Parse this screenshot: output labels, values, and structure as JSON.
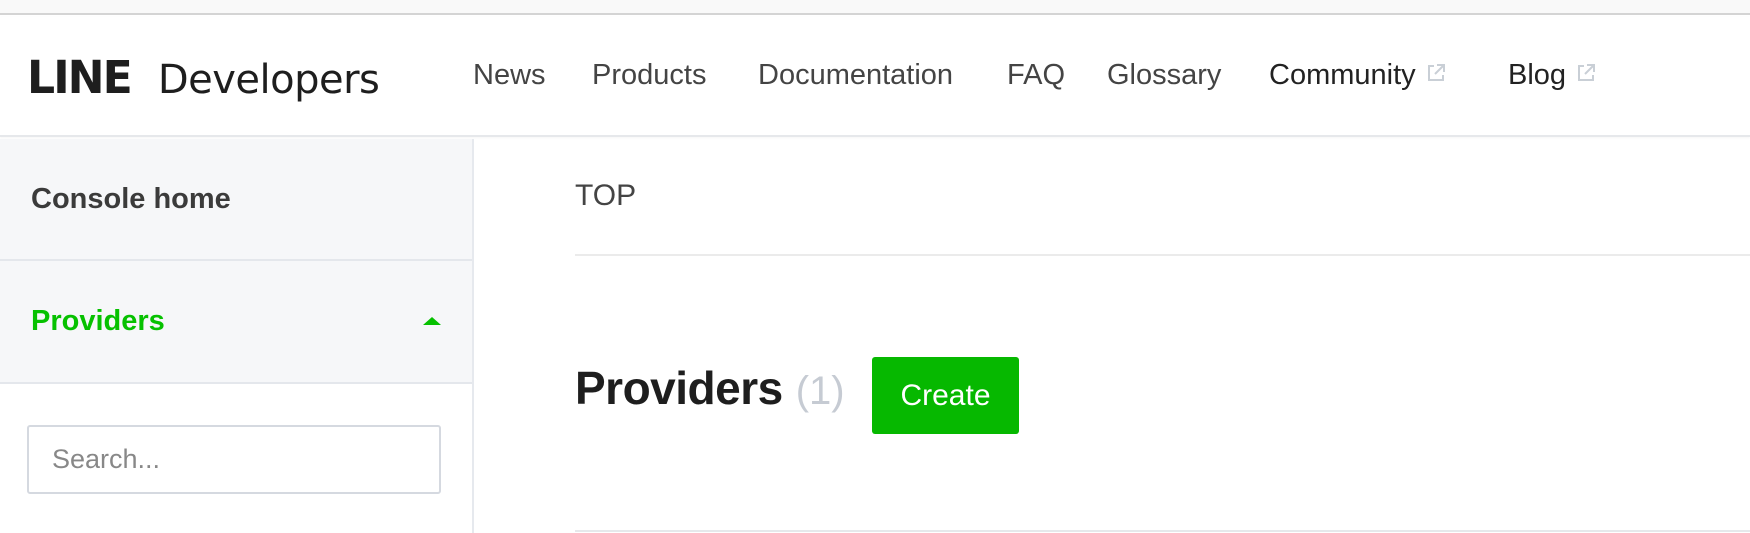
{
  "header": {
    "logo_brand": "LINE",
    "logo_product": "Developers",
    "nav": [
      {
        "label": "News",
        "external": false
      },
      {
        "label": "Products",
        "external": false
      },
      {
        "label": "Documentation",
        "external": false
      },
      {
        "label": "FAQ",
        "external": false
      },
      {
        "label": "Glossary",
        "external": false
      },
      {
        "label": "Community",
        "external": true,
        "icon": "external-link-icon"
      },
      {
        "label": "Blog",
        "external": true,
        "icon": "external-link-icon"
      }
    ]
  },
  "sidebar": {
    "items": [
      {
        "label": "Console home",
        "active": false
      },
      {
        "label": "Providers",
        "active": true,
        "expanded": true,
        "icon": "caret-up-icon"
      }
    ],
    "search": {
      "placeholder": "Search...",
      "value": ""
    }
  },
  "main": {
    "breadcrumb": "TOP",
    "title": "Providers",
    "count": "(1)",
    "create_label": "Create"
  },
  "colors": {
    "accent": "#06c100",
    "button": "#06b800",
    "sidebar_bg": "#f6f7f9",
    "count_text": "#c6cbd3"
  }
}
